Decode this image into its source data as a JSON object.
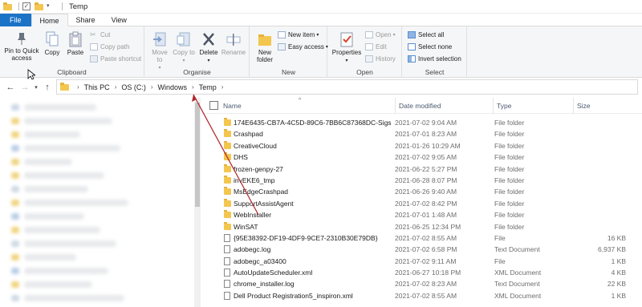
{
  "window": {
    "title": "Temp"
  },
  "tabs": [
    "File",
    "Home",
    "Share",
    "View"
  ],
  "ribbon": {
    "clipboard": {
      "label": "Clipboard",
      "pin": "Pin to Quick access",
      "copy": "Copy",
      "paste": "Paste",
      "cut": "Cut",
      "copy_path": "Copy path",
      "paste_shortcut": "Paste shortcut"
    },
    "organise": {
      "label": "Organise",
      "move_to": "Move to",
      "copy_to": "Copy to",
      "delete": "Delete",
      "rename": "Rename"
    },
    "new": {
      "label": "New",
      "new_folder": "New folder",
      "new_item": "New item",
      "easy_access": "Easy access"
    },
    "open": {
      "label": "Open",
      "properties": "Properties",
      "open": "Open",
      "edit": "Edit",
      "history": "History"
    },
    "select": {
      "label": "Select",
      "select_all": "Select all",
      "select_none": "Select none",
      "invert": "Invert selection"
    }
  },
  "breadcrumb": [
    "This PC",
    "OS (C:)",
    "Windows",
    "Temp"
  ],
  "columns": {
    "name": "Name",
    "date": "Date modified",
    "type": "Type",
    "size": "Size"
  },
  "files": [
    {
      "name": "174E6435-CB7A-4C5D-89C6-7BB6C87368DC-Sigs",
      "date": "2021-07-02 9:04 AM",
      "type": "File folder",
      "size": "",
      "kind": "folder"
    },
    {
      "name": "Crashpad",
      "date": "2021-07-01 8:23 AM",
      "type": "File folder",
      "size": "",
      "kind": "folder"
    },
    {
      "name": "CreativeCloud",
      "date": "2021-01-26 10:29 AM",
      "type": "File folder",
      "size": "",
      "kind": "folder"
    },
    {
      "name": "DHS",
      "date": "2021-07-02 9:05 AM",
      "type": "File folder",
      "size": "",
      "kind": "folder"
    },
    {
      "name": "frozen-genpy-27",
      "date": "2021-06-22 5:27 PM",
      "type": "File folder",
      "size": "",
      "kind": "folder"
    },
    {
      "name": "invEKE6_tmp",
      "date": "2021-06-28 8:07 PM",
      "type": "File folder",
      "size": "",
      "kind": "folder"
    },
    {
      "name": "MsEdgeCrashpad",
      "date": "2021-06-26 9:40 AM",
      "type": "File folder",
      "size": "",
      "kind": "folder"
    },
    {
      "name": "SupportAssistAgent",
      "date": "2021-07-02 8:42 PM",
      "type": "File folder",
      "size": "",
      "kind": "folder"
    },
    {
      "name": "WebInstaller",
      "date": "2021-07-01 1:48 AM",
      "type": "File folder",
      "size": "",
      "kind": "folder"
    },
    {
      "name": "WinSAT",
      "date": "2021-06-25 12:34 PM",
      "type": "File folder",
      "size": "",
      "kind": "folder"
    },
    {
      "name": "{95E38392-DF19-4DF9-9CE7-2310B30E79DB}",
      "date": "2021-07-02 8:55 AM",
      "type": "File",
      "size": "16 KB",
      "kind": "doc"
    },
    {
      "name": "adobegc.log",
      "date": "2021-07-02 6:58 PM",
      "type": "Text Document",
      "size": "6,937 KB",
      "kind": "doc"
    },
    {
      "name": "adobegc_a03400",
      "date": "2021-07-02 9:11 AM",
      "type": "File",
      "size": "1 KB",
      "kind": "doc"
    },
    {
      "name": "AutoUpdateScheduler.xml",
      "date": "2021-06-27 10:18 PM",
      "type": "XML Document",
      "size": "4 KB",
      "kind": "doc"
    },
    {
      "name": "chrome_installer.log",
      "date": "2021-07-02 8:23 AM",
      "type": "Text Document",
      "size": "22 KB",
      "kind": "doc"
    },
    {
      "name": "Dell Product Registration5_inspiron.xml",
      "date": "2021-07-02 8:55 AM",
      "type": "XML Document",
      "size": "1 KB",
      "kind": "doc"
    }
  ],
  "colors": {
    "file_tab": "#1a73c7",
    "folder": "#f3c64f",
    "arrow": "#b0262c"
  }
}
